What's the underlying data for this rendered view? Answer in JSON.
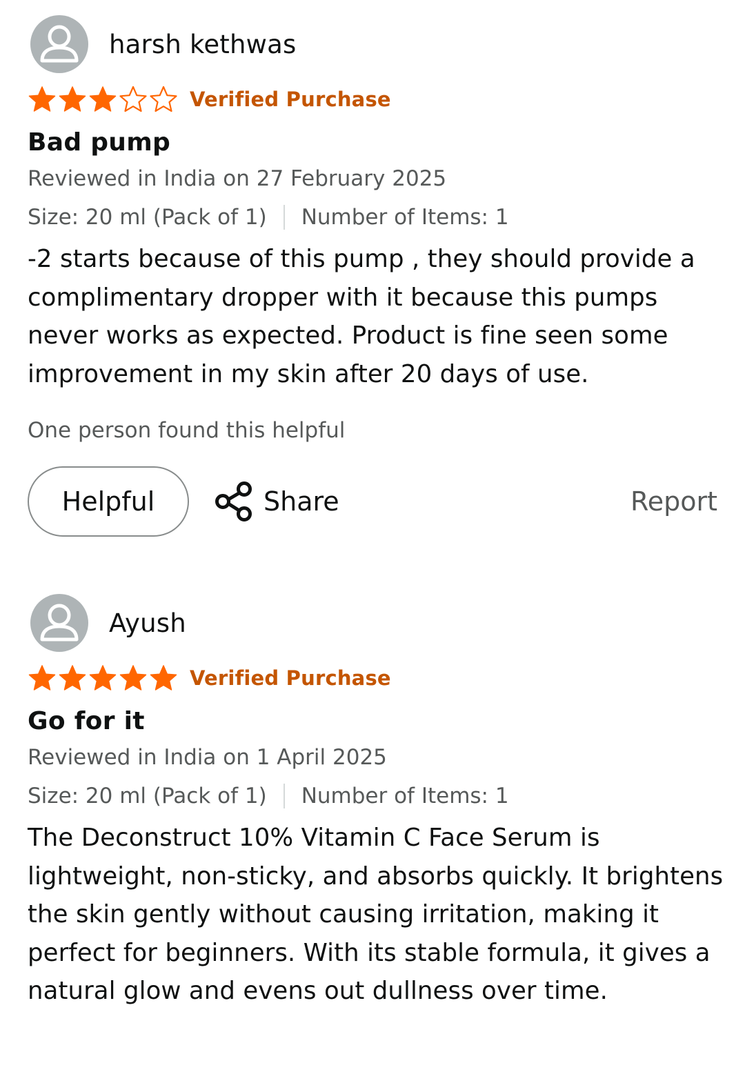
{
  "colors": {
    "star_fill": "#ff6600",
    "verified": "#c45500",
    "avatar_bg": "#aeb4b6",
    "secondary_text": "#565959"
  },
  "reviews": [
    {
      "reviewer_name": "harsh kethwas",
      "avatar_icon": "user-avatar-icon",
      "rating": 3,
      "max_rating": 5,
      "verified_label": "Verified Purchase",
      "title": "Bad pump",
      "date": "Reviewed in India on 27 February 2025",
      "size": "Size: 20 ml (Pack of 1)",
      "items": "Number of Items: 1",
      "body": "-2 starts because of this pump , they should provide a complimentary dropper with it because this pumps never works as expected. Product is fine seen some improvement in my skin after 20 days of use.",
      "helpful_count": "One person found this helpful",
      "helpful_button": "Helpful",
      "share_label": "Share",
      "share_icon": "share-icon",
      "report_label": "Report"
    },
    {
      "reviewer_name": "Ayush",
      "avatar_icon": "user-avatar-icon",
      "rating": 5,
      "max_rating": 5,
      "verified_label": "Verified Purchase",
      "title": "Go for it",
      "date": "Reviewed in India on 1 April 2025",
      "size": "Size: 20 ml (Pack of 1)",
      "items": "Number of Items: 1",
      "body": "The Deconstruct 10% Vitamin C Face Serum is lightweight, non-sticky, and absorbs quickly. It brightens the skin gently without causing irritation, making it perfect for beginners. With its stable formula, it gives a natural glow and evens out dullness over time."
    }
  ]
}
